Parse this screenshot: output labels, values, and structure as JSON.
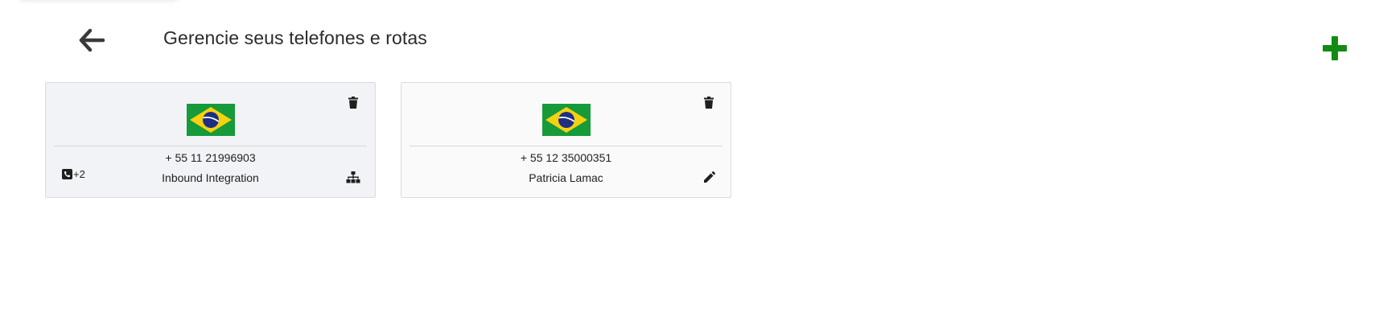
{
  "header": {
    "title": "Gerencie seus telefones e rotas",
    "back_icon": "arrow-left-icon",
    "add_icon": "plus-icon",
    "add_color": "#138a13"
  },
  "cards": [
    {
      "flag": "brazil-flag",
      "phone": "+ 55 11 21996903",
      "name": "Inbound Integration",
      "extra_phones": "+2",
      "side_icon": "sitemap-icon",
      "delete_icon": "trash-icon"
    },
    {
      "flag": "brazil-flag",
      "phone": "+ 55 12 35000351",
      "name": "Patricia Lamac",
      "side_icon": "pencil-icon",
      "delete_icon": "trash-icon"
    }
  ]
}
